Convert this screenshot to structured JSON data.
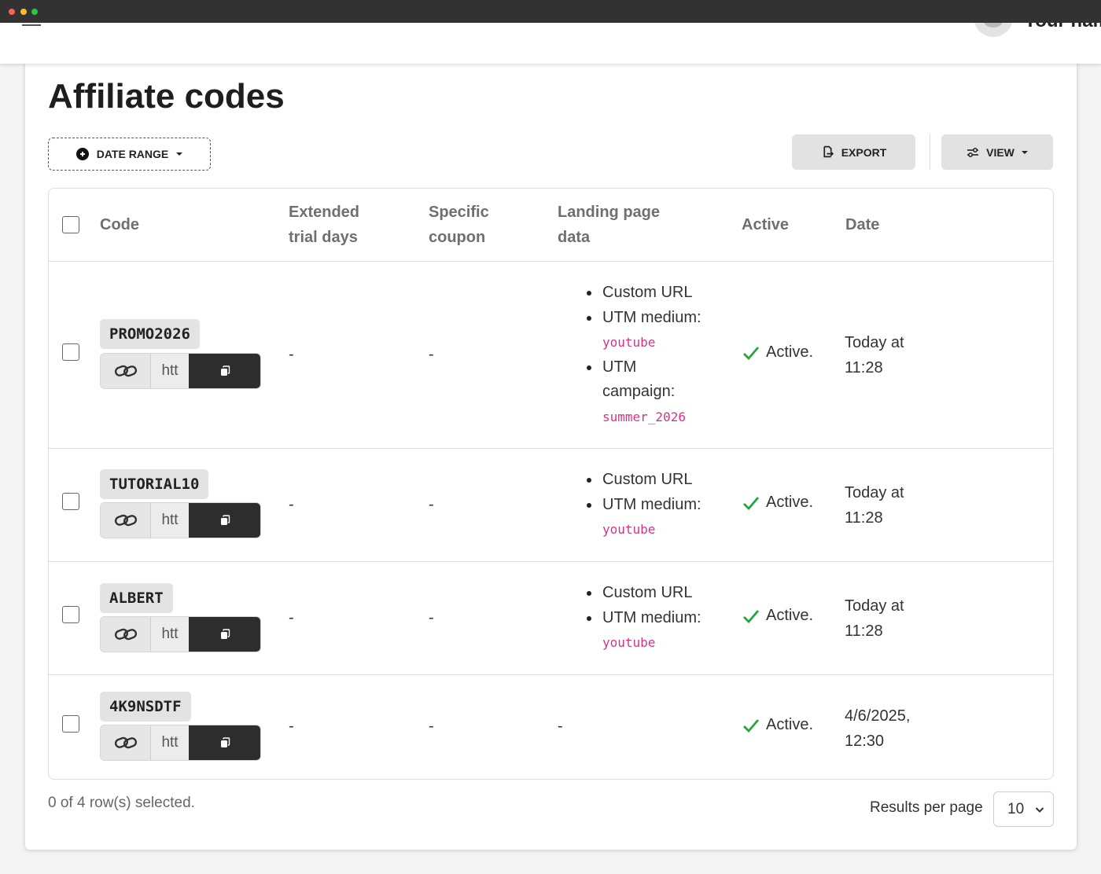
{
  "header": {
    "user_name": "Your name"
  },
  "page": {
    "title": "Affiliate codes"
  },
  "toolbar": {
    "date_range_label": "DATE RANGE",
    "export_label": "EXPORT",
    "view_label": "VIEW"
  },
  "table": {
    "headers": {
      "code": "Code",
      "extended_trial_line1": "Extended",
      "extended_trial_line2": "trial days",
      "specific_coupon_line1": "Specific",
      "specific_coupon_line2": "coupon",
      "landing_line1": "Landing page",
      "landing_line2": "data",
      "active": "Active",
      "date": "Date"
    },
    "rows": [
      {
        "code": "PROMO2026",
        "url_preview": "htt",
        "extended_trial": "-",
        "specific_coupon": "-",
        "lp_custom_url": "Custom URL",
        "lp_utm_medium": "UTM medium:",
        "lp_utm_medium_value": "youtube",
        "lp_utm_campaign": "UTM campaign:",
        "lp_utm_campaign_value": "summer_2026",
        "active": "Active.",
        "date_line1": "Today at",
        "date_line2": "11:28"
      },
      {
        "code": "TUTORIAL10",
        "url_preview": "htt",
        "extended_trial": "-",
        "specific_coupon": "-",
        "lp_custom_url": "Custom URL",
        "lp_utm_medium": "UTM medium:",
        "lp_utm_medium_value": "youtube",
        "active": "Active.",
        "date_line1": "Today at",
        "date_line2": "11:28"
      },
      {
        "code": "ALBERT",
        "url_preview": "htt",
        "extended_trial": "-",
        "specific_coupon": "-",
        "lp_custom_url": "Custom URL",
        "lp_utm_medium": "UTM medium:",
        "lp_utm_medium_value": "youtube",
        "active": "Active.",
        "date_line1": "Today at",
        "date_line2": "11:28"
      },
      {
        "code": "4K9NSDTF",
        "url_preview": "htt",
        "extended_trial": "-",
        "specific_coupon": "-",
        "landing_page": "-",
        "active": "Active.",
        "date_line1": "4/6/2025,",
        "date_line2": "12:30"
      }
    ]
  },
  "footer": {
    "selection_text": "0 of 4 row(s) selected.",
    "results_per_page_label": "Results per page",
    "results_per_page_value": "10"
  },
  "colors": {
    "active_check": "#22a83a",
    "utm_value": "#d63384",
    "copy_button": "#2d2d2d"
  }
}
